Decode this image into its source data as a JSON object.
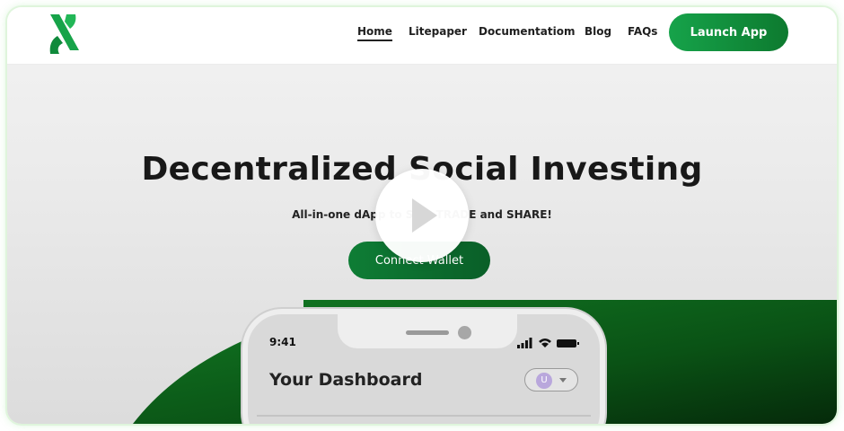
{
  "nav": {
    "logo": "aleph-logo-icon",
    "links": [
      {
        "label": "Home",
        "active": true
      },
      {
        "label": "Litepaper"
      },
      {
        "label": "Documentatiom"
      },
      {
        "label": "Blog"
      },
      {
        "label": "FAQs"
      }
    ],
    "launch_label": "Launch App"
  },
  "hero": {
    "title": "Decentralized Social Investing",
    "subtitle": "All-in-one dApp to SEE, TRADE and SHARE!",
    "connect_label": "Connect Wallet"
  },
  "phone": {
    "time": "9:41",
    "dashboard_title": "Your Dashboard",
    "user_initial": "U",
    "status_icons": [
      "signal-icon",
      "wifi-icon",
      "battery-icon"
    ]
  },
  "overlay": {
    "icon": "play-icon"
  },
  "colors": {
    "brand_green": "#16a34a",
    "dark_green": "#0a5f28",
    "text": "#181818"
  }
}
